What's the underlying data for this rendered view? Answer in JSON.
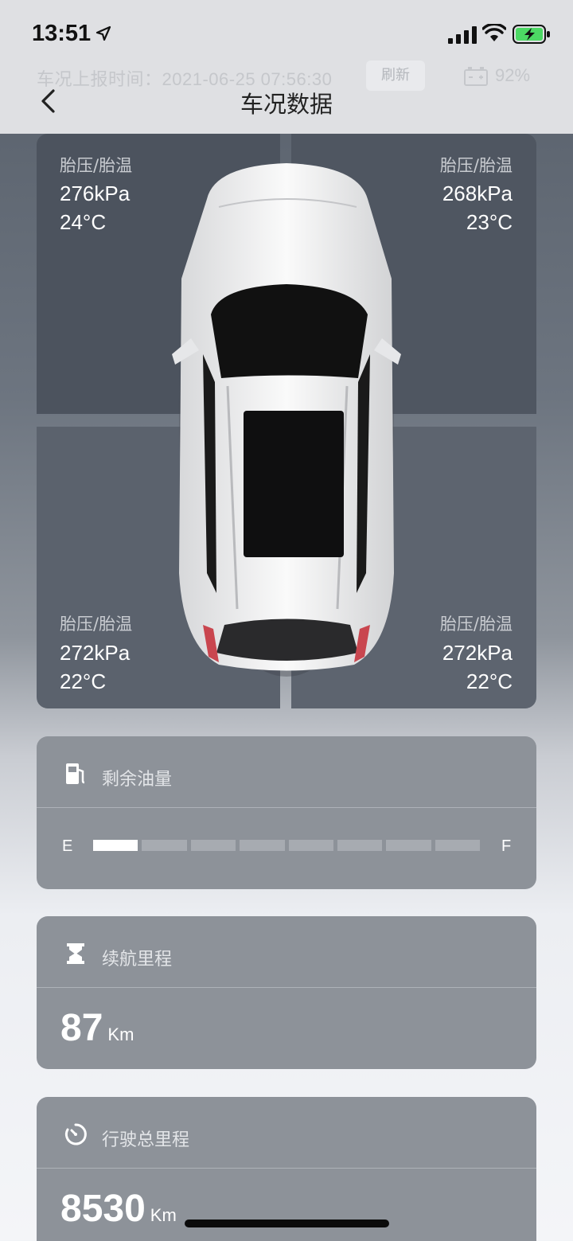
{
  "status_bar": {
    "time": "13:51"
  },
  "header": {
    "report_label": "车况上报时间：",
    "report_time": "2021-06-25 07:56:30",
    "refresh_label": "刷新",
    "car_battery": "92%",
    "title": "车况数据"
  },
  "tires": {
    "front_left": {
      "label": "胎压/胎温",
      "pressure": "276kPa",
      "temp": "24°C"
    },
    "front_right": {
      "label": "胎压/胎温",
      "pressure": "268kPa",
      "temp": "23°C"
    },
    "rear_left": {
      "label": "胎压/胎温",
      "pressure": "272kPa",
      "temp": "22°C"
    },
    "rear_right": {
      "label": "胎压/胎温",
      "pressure": "272kPa",
      "temp": "22°C"
    }
  },
  "fuel": {
    "label": "剩余油量",
    "empty_mark": "E",
    "full_mark": "F",
    "segments_total": 8,
    "segments_filled": 1
  },
  "range": {
    "label": "续航里程",
    "value": "87",
    "unit": "Km"
  },
  "odometer": {
    "label": "行驶总里程",
    "value": "8530",
    "unit": "Km"
  },
  "icons": {
    "location": "location-arrow-icon",
    "signal": "cellular-signal-icon",
    "wifi": "wifi-icon",
    "battery": "battery-charging-icon",
    "car_battery": "car-battery-icon",
    "back": "back-chevron-icon",
    "fuel": "fuel-pump-icon",
    "range": "hourglass-icon",
    "odometer": "timer-icon"
  },
  "colors": {
    "battery_green": "#4cd964",
    "card_bg": "#8d9299"
  }
}
